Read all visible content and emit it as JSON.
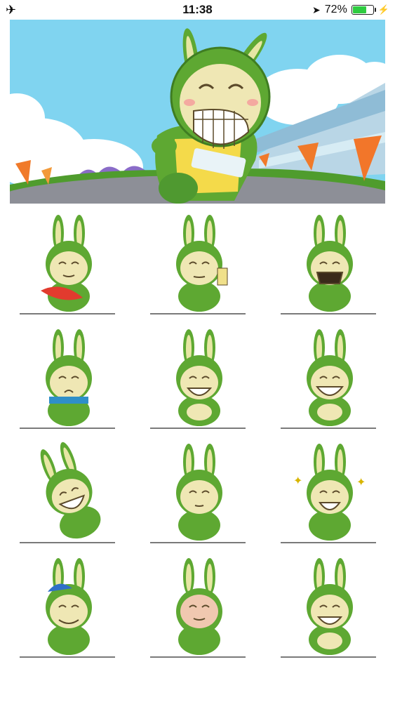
{
  "status_bar": {
    "time": "11:38",
    "battery_percent": "72%",
    "battery_level": 0.72,
    "icons": [
      "airplane-icon",
      "location-arrow-icon",
      "battery-icon",
      "charging-bolt-icon"
    ]
  },
  "banner": {
    "image": "rabbit-mascot-stadium-banner"
  },
  "stickers": [
    {
      "name": "sticker-eating-carrot"
    },
    {
      "name": "sticker-phone-selfie"
    },
    {
      "name": "sticker-shouting"
    },
    {
      "name": "sticker-dizzy-scarf"
    },
    {
      "name": "sticker-grin-hands"
    },
    {
      "name": "sticker-big-grin"
    },
    {
      "name": "sticker-rolling-laugh"
    },
    {
      "name": "sticker-calm-face"
    },
    {
      "name": "sticker-sparkle-excited"
    },
    {
      "name": "sticker-sleepy-cap"
    },
    {
      "name": "sticker-lying-down"
    },
    {
      "name": "sticker-grin-belly"
    }
  ],
  "colors": {
    "rabbit_green": "#5ea832",
    "rabbit_dark": "#3f7d22",
    "face": "#efe7b4",
    "sky": "#7fd4f2",
    "battery": "#2ecc40"
  }
}
